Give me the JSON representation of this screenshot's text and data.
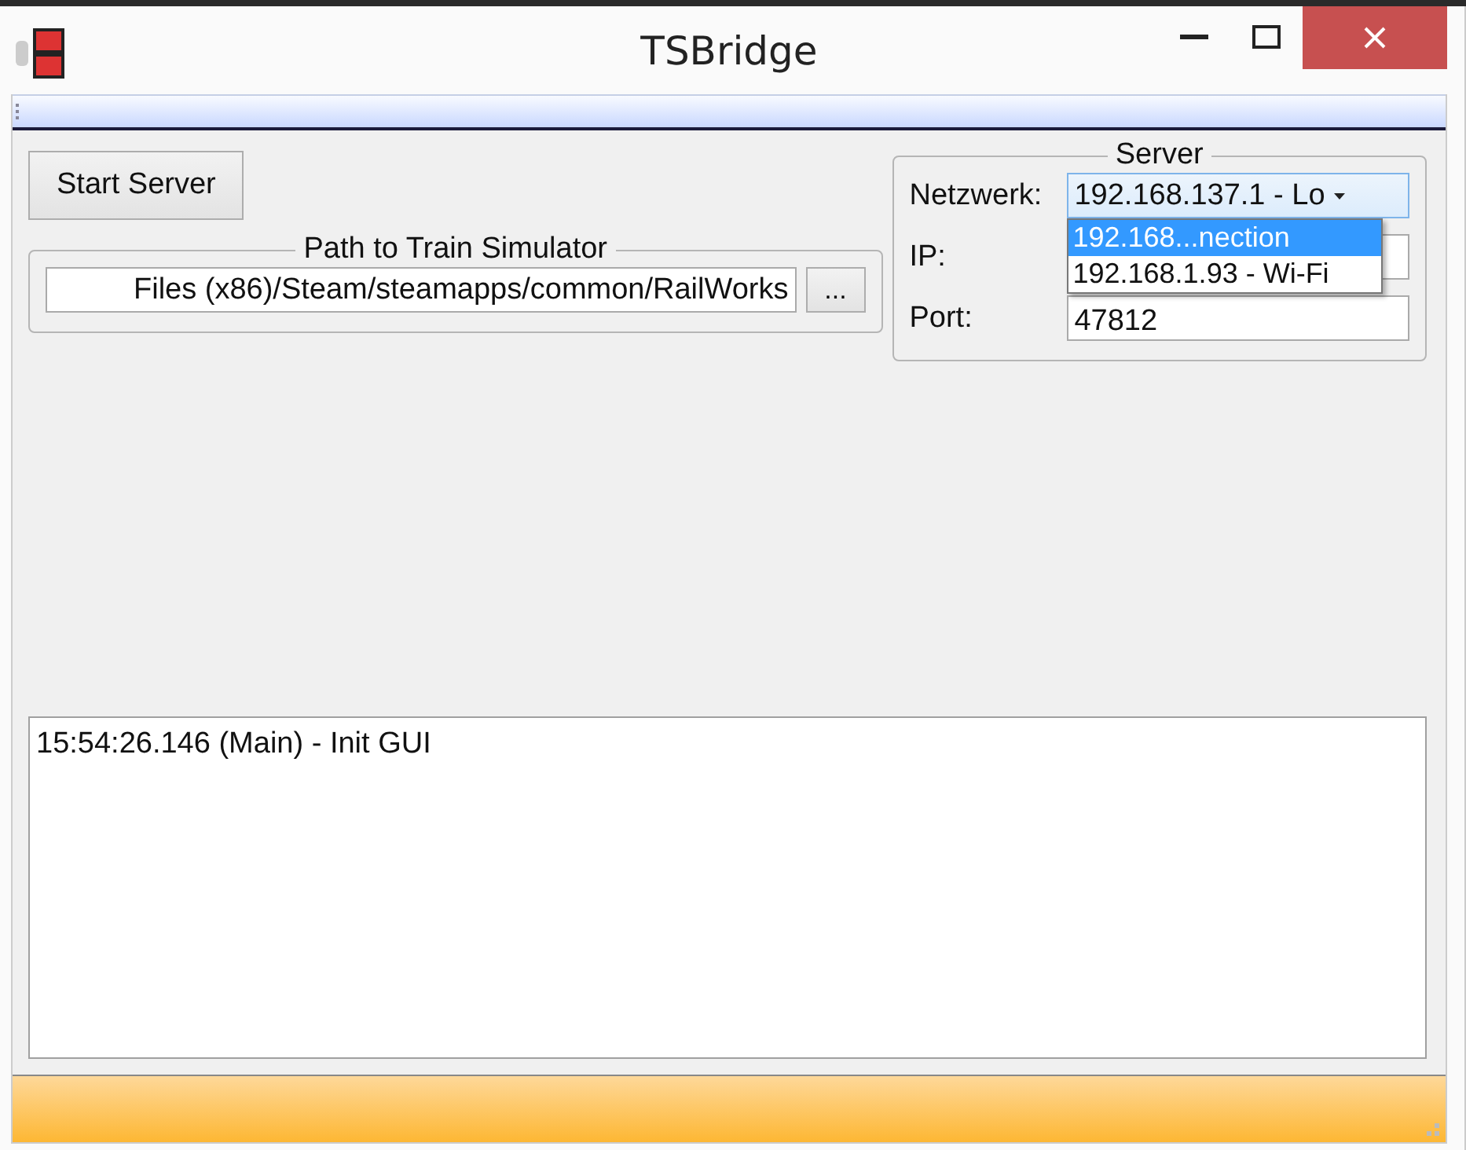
{
  "window": {
    "title": "TSBridge"
  },
  "start_button": "Start Server",
  "path_group": {
    "title": "Path to Train Simulator",
    "value": "Files (x86)/Steam/steamapps/common/RailWorks",
    "browse_button": "..."
  },
  "server_group": {
    "title": "Server",
    "network": {
      "label": "Netzwerk:",
      "value": "192.168.137.1 - Lo",
      "expanded": true,
      "options": [
        {
          "label": "192.168...nection",
          "selected": true
        },
        {
          "label": "192.168.1.93 - Wi-Fi",
          "selected": false
        }
      ]
    },
    "ip": {
      "label": "IP:"
    },
    "port": {
      "label": "Port:",
      "value": "47812"
    }
  },
  "log": {
    "lines": [
      "15:54:26.146 (Main) - Init GUI"
    ]
  }
}
